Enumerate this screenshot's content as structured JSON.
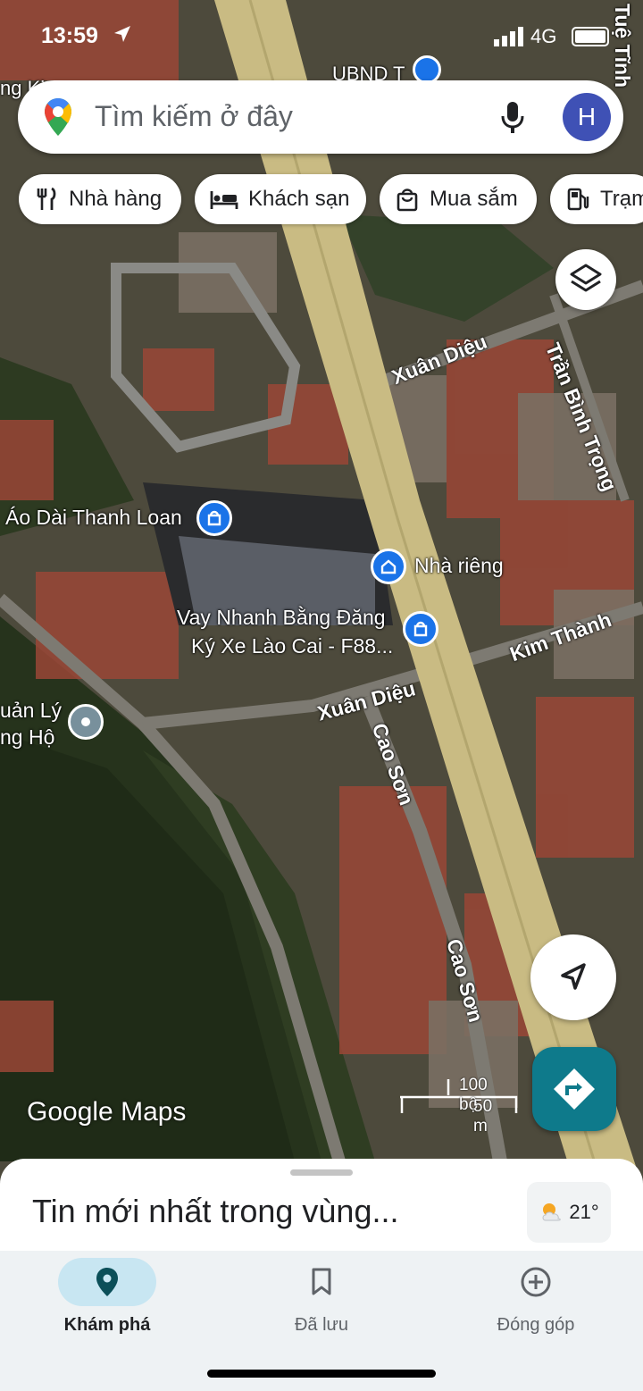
{
  "status_bar": {
    "time": "13:59",
    "network": "4G"
  },
  "search": {
    "placeholder": "Tìm kiếm ở đây",
    "avatar_initial": "H"
  },
  "chips": [
    {
      "label": "Nhà hàng",
      "icon": "restaurant-icon"
    },
    {
      "label": "Khách sạn",
      "icon": "hotel-icon"
    },
    {
      "label": "Mua sắm",
      "icon": "shopping-icon"
    },
    {
      "label": "Trạm",
      "icon": "gas-station-icon"
    }
  ],
  "map": {
    "top_labels": {
      "ubnd": "UBND T",
      "tue_tinh": "Tuệ Tĩnh",
      "left_top": "ng Kim"
    },
    "streets": {
      "xuan_dieu_1": "Xuân Diệu",
      "xuan_dieu_2": "Xuân Diệu",
      "tran_binh_trong": "Trần Bình Trọng",
      "kim_thanh": "Kim Thành",
      "cao_son_1": "Cao Sơn",
      "cao_son_2": "Cao Sơn"
    },
    "places": {
      "ao_dai": "Áo Dài Thanh Loan",
      "nha_rieng": "Nhà riêng",
      "vay_line1": "Vay Nhanh Bằng Đăng",
      "vay_line2": "Ký Xe Lào Cai - F88...",
      "quan_ly_line1": "uản Lý",
      "quan_ly_line2": "ng Hộ"
    },
    "scale": {
      "feet": "100 bộ",
      "meters": "50 m"
    },
    "watermark": "Google Maps"
  },
  "sheet": {
    "title": "Tin mới nhất trong vùng...",
    "temperature": "21°"
  },
  "nav": [
    {
      "label": "Khám phá",
      "icon": "explore-pin-icon",
      "active": true
    },
    {
      "label": "Đã lưu",
      "icon": "bookmark-icon",
      "active": false
    },
    {
      "label": "Đóng góp",
      "icon": "add-circle-icon",
      "active": false
    }
  ]
}
